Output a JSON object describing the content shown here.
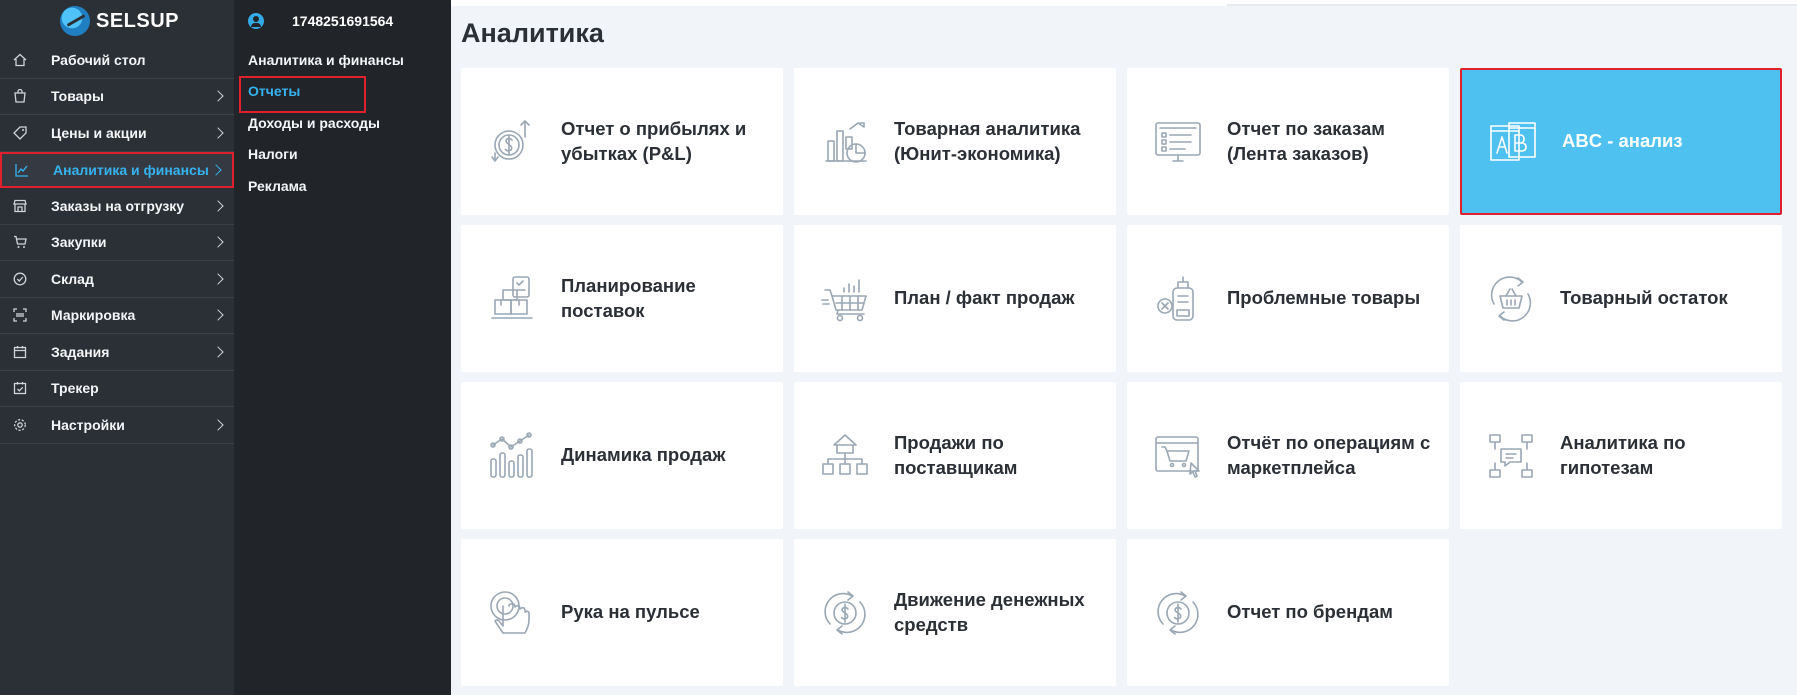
{
  "brand": {
    "name": "SELSUP"
  },
  "sidebar": {
    "items": [
      {
        "label": "Рабочий стол",
        "icon": "home-icon",
        "chevron": false
      },
      {
        "label": "Товары",
        "icon": "shopping-bag-icon",
        "chevron": true
      },
      {
        "label": "Цены и акции",
        "icon": "tag-icon",
        "chevron": true
      },
      {
        "label": "Аналитика и финансы",
        "icon": "chart-line-icon",
        "chevron": true,
        "active": true
      },
      {
        "label": "Заказы на отгрузку",
        "icon": "store-icon",
        "chevron": true
      },
      {
        "label": "Закупки",
        "icon": "cart-icon",
        "chevron": true
      },
      {
        "label": "Склад",
        "icon": "check-circle-icon",
        "chevron": true
      },
      {
        "label": "Маркировка",
        "icon": "barcode-icon",
        "chevron": true
      },
      {
        "label": "Задания",
        "icon": "calendar-icon",
        "chevron": true
      },
      {
        "label": "Трекер",
        "icon": "calendar-check-icon",
        "chevron": false
      },
      {
        "label": "Настройки",
        "icon": "gear-icon",
        "chevron": true
      }
    ]
  },
  "account": {
    "id": "1748251691564"
  },
  "subnav": {
    "items": [
      {
        "label": "Аналитика и финансы"
      },
      {
        "label": "Отчеты",
        "active": true
      },
      {
        "label": "Доходы и расходы"
      },
      {
        "label": "Налоги"
      },
      {
        "label": "Реклама"
      }
    ]
  },
  "main": {
    "title": "Аналитика",
    "cards": [
      {
        "title": "Отчет о прибылях и убытках (P&L)",
        "icon": "profit-loss-icon"
      },
      {
        "title": "Товарная аналитика (Юнит-экономика)",
        "icon": "product-analytics-icon"
      },
      {
        "title": "Отчет по заказам (Лента заказов)",
        "icon": "orders-report-icon"
      },
      {
        "title": "ABC - анализ",
        "icon": "abc-analysis-icon",
        "highlight": true
      },
      {
        "title": "Планирование поставок",
        "icon": "supply-planning-icon"
      },
      {
        "title": "План / факт продаж",
        "icon": "plan-fact-icon"
      },
      {
        "title": "Проблемные товары",
        "icon": "problem-products-icon"
      },
      {
        "title": "Товарный остаток",
        "icon": "stock-balance-icon"
      },
      {
        "title": "Динамика продаж",
        "icon": "sales-dynamics-icon"
      },
      {
        "title": "Продажи по поставщикам",
        "icon": "supplier-sales-icon"
      },
      {
        "title": "Отчёт по операциям с маркетплейса",
        "icon": "marketplace-ops-icon"
      },
      {
        "title": "Аналитика по гипотезам",
        "icon": "hypotheses-icon"
      },
      {
        "title": "Рука на пульсе",
        "icon": "hand-pulse-icon"
      },
      {
        "title": "Движение денежных средств",
        "icon": "cash-flow-icon"
      },
      {
        "title": "Отчет по брендам",
        "icon": "brands-report-icon"
      }
    ]
  },
  "colors": {
    "accent": "#35b3f0",
    "highlight": "#4fc1f0",
    "selection": "#e0212d",
    "sidebar": "#2b2f36",
    "subsidebar": "#212429"
  }
}
